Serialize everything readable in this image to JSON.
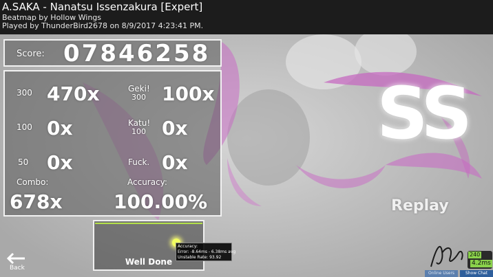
{
  "header": {
    "title": "A.SAKA - Nanatsu Issenzakura [Expert]",
    "beatmap": "Beatmap by Hollow Wings",
    "played_by": "Played by ThunderBird2678 on 8/9/2017 4:23:41 PM."
  },
  "score": {
    "label": "Score:",
    "value": "07846258"
  },
  "stats": {
    "h300_label": "300",
    "h300_value": "470x",
    "geki_label": "Geki!",
    "geki_sub": "300",
    "geki_value": "100x",
    "h100_label": "100",
    "h100_value": "0x",
    "katu_label": "Katu!",
    "katu_sub": "100",
    "katu_value": "0x",
    "h50_label": "50",
    "h50_value": "0x",
    "miss_label": "Fuck.",
    "miss_value": "0x",
    "combo_label": "Combo:",
    "combo_value": "678x",
    "accuracy_label": "Accuracy:",
    "accuracy_value": "100.00%"
  },
  "grade": "SS",
  "replay_label": "Replay",
  "graph": {
    "label": "Well Done",
    "tooltip": {
      "line1": "Accuracy:",
      "line2": "Error: -8.64ms - 6.38ms avg",
      "line3": "Unstable Rate: 93.92"
    }
  },
  "back_label": "Back",
  "fps": {
    "line1": "240",
    "line2": "4.2ms"
  },
  "bottom_buttons": {
    "online_users": "Online Users",
    "show_chat": "Show Chat"
  },
  "colors": {
    "header_bg": "#1c1c1c",
    "graph_line": "#b4e14a",
    "fps_green": "#8ad24b",
    "background_pink": "#d070c8"
  }
}
